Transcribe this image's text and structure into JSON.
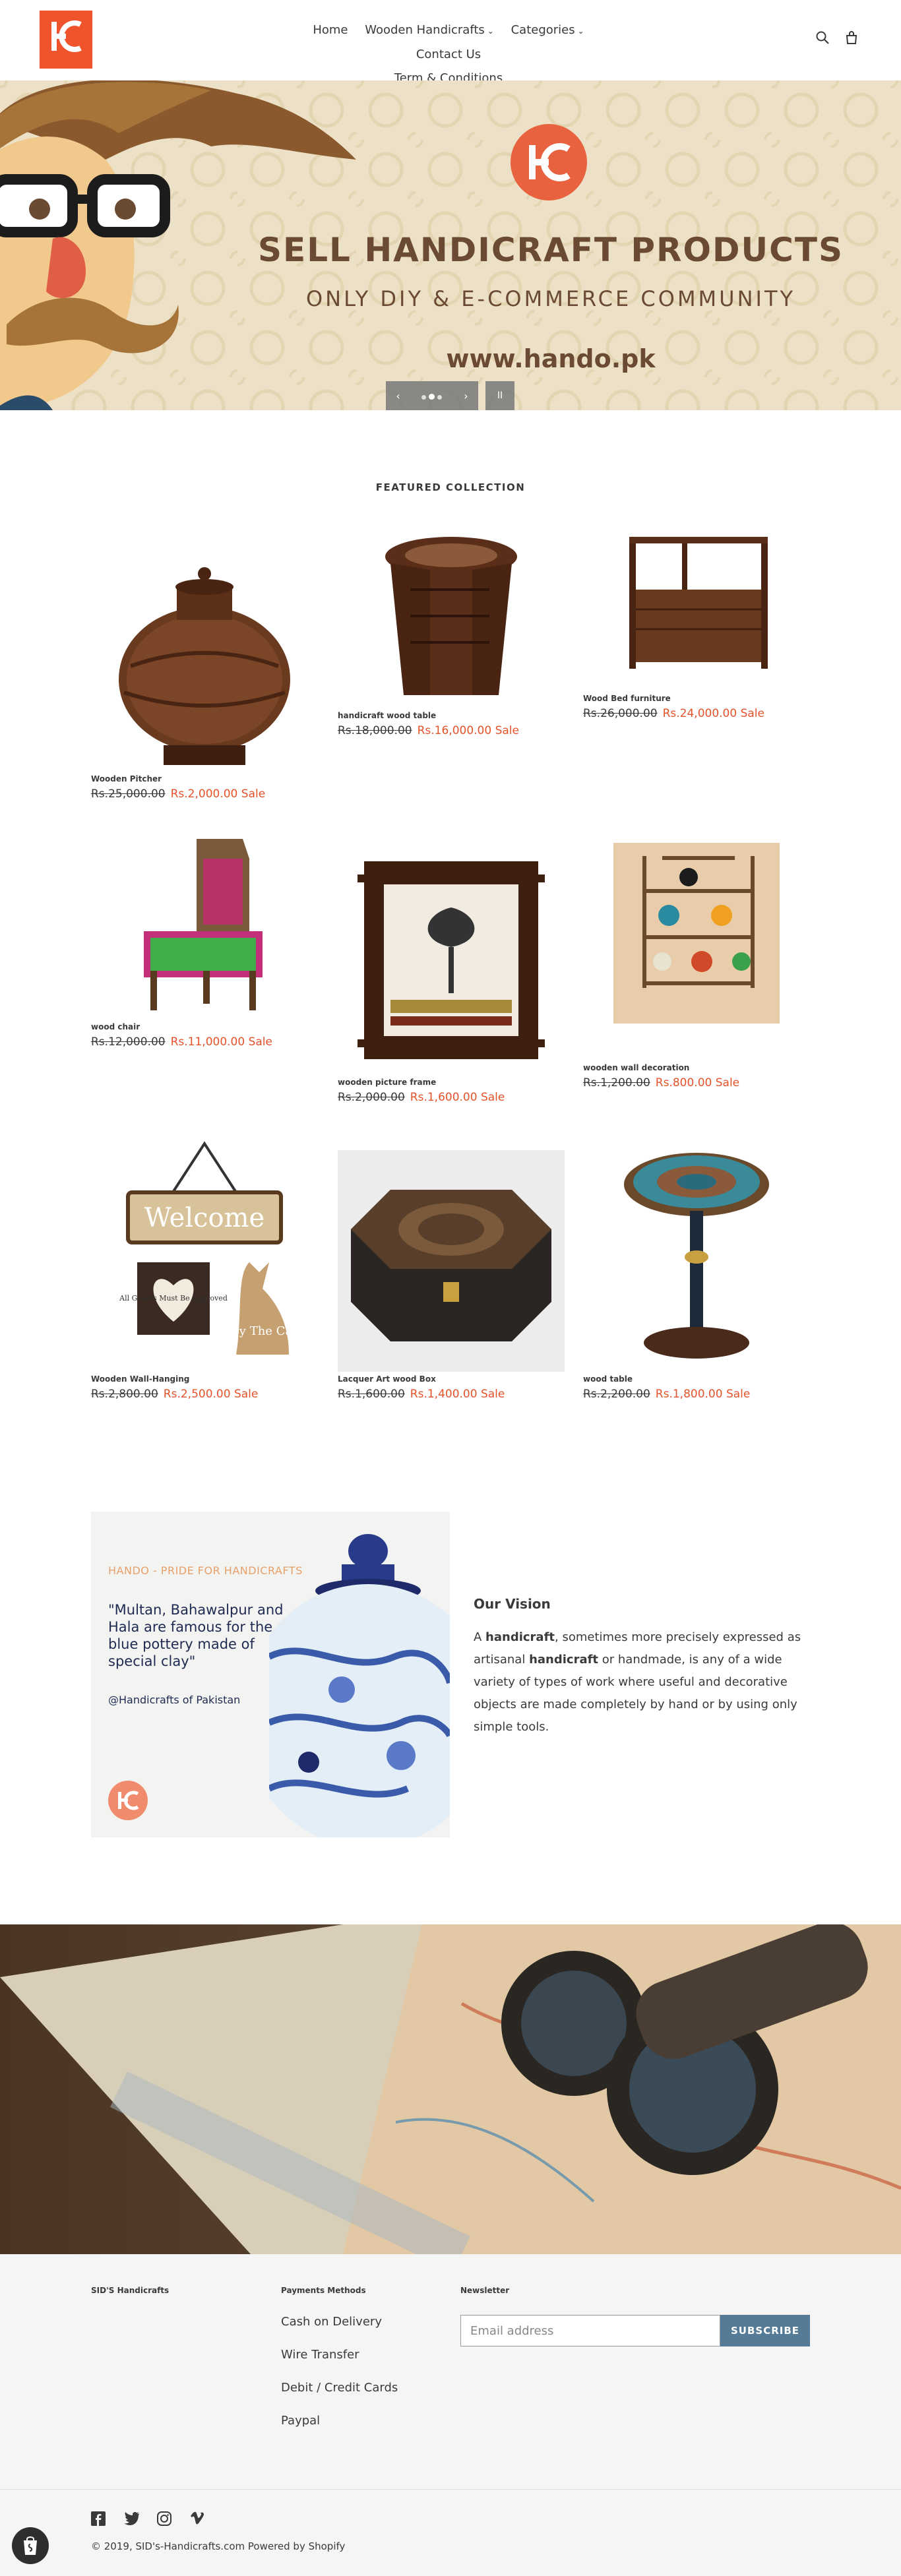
{
  "header": {
    "logo_text": "HC",
    "nav": [
      {
        "label": "Home"
      },
      {
        "label": "Wooden Handicrafts"
      },
      {
        "label": "Categories"
      },
      {
        "label": "Contact Us"
      },
      {
        "label": "Term & Conditions"
      }
    ],
    "icons": [
      "search-icon",
      "cart-icon"
    ]
  },
  "hero": {
    "logo_text": "HC",
    "title": "SELL HANDICRAFT PRODUCTS",
    "subtitle": "ONLY DIY & E-COMMERCE COMMUNITY",
    "url": "www.hando.pk",
    "slider": {
      "prev": "‹",
      "next": "›",
      "pause": "II",
      "slide_count": 3,
      "active_slide": 2
    }
  },
  "featured": {
    "title": "FEATURED COLLECTION",
    "products": [
      {
        "name": "Wooden Pitcher",
        "old_price": "Rs.25,000.00",
        "sale_price": "Rs.2,000.00 Sale"
      },
      {
        "name": "handicraft wood table",
        "old_price": "Rs.18,000.00",
        "sale_price": "Rs.16,000.00 Sale"
      },
      {
        "name": "Wood Bed furniture",
        "old_price": "Rs.26,000.00",
        "sale_price": "Rs.24,000.00 Sale"
      },
      {
        "name": "wood chair",
        "old_price": "Rs.12,000.00",
        "sale_price": "Rs.11,000.00 Sale"
      },
      {
        "name": "wooden picture frame",
        "old_price": "Rs.2,000.00",
        "sale_price": "Rs.1,600.00 Sale"
      },
      {
        "name": "wooden wall decoration",
        "old_price": "Rs.1,200.00",
        "sale_price": "Rs.800.00 Sale"
      },
      {
        "name": "Wooden Wall-Hanging",
        "old_price": "Rs.2,800.00",
        "sale_price": "Rs.2,500.00 Sale"
      },
      {
        "name": "Lacquer Art wood Box",
        "old_price": "Rs.1,600.00",
        "sale_price": "Rs.1,400.00 Sale"
      },
      {
        "name": "wood table",
        "old_price": "Rs.2,200.00",
        "sale_price": "Rs.1,800.00 Sale"
      }
    ],
    "wall_hanging_sign": {
      "welcome": "Welcome",
      "note": "All Guests Must Be Approved",
      "cat": "By The Cat"
    }
  },
  "vision": {
    "image": {
      "brand": "HANDO - PRIDE FOR HANDICRAFTS",
      "quote": "\"Multan, Bahawalpur and Hala are famous for the blue pottery made of special clay\"",
      "handle": "@Handicrafts of Pakistan",
      "logo_text": "HC"
    },
    "title": "Our Vision",
    "text_parts": [
      {
        "text": "A ",
        "bold": false
      },
      {
        "text": "handicraft",
        "bold": true
      },
      {
        "text": ", sometimes more precisely expressed as artisanal ",
        "bold": false
      },
      {
        "text": "handicraft",
        "bold": true
      },
      {
        "text": " or handmade, is any of a wide variety of types of work where useful and decorative objects are made completely by hand or by using only simple tools.",
        "bold": false
      }
    ]
  },
  "footer": {
    "col1_title": "SID'S Handicrafts",
    "payments_title": "Payments Methods",
    "payments": [
      "Cash on Delivery",
      "Wire Transfer",
      "Debit / Credit Cards",
      "Paypal"
    ],
    "newsletter_title": "Newsletter",
    "newsletter_placeholder": "Email address",
    "subscribe_label": "SUBSCRIBE",
    "social_icons": [
      "facebook-icon",
      "twitter-icon",
      "instagram-icon",
      "vimeo-icon"
    ],
    "copyright": "© 2019, SID's-Handicrafts.com Powered by Shopify"
  },
  "colors": {
    "accent": "#f0542d",
    "sale": "#e5522a",
    "button": "#557b97",
    "hero_bg": "#ece1c6",
    "hero_text": "#6b4a34"
  }
}
